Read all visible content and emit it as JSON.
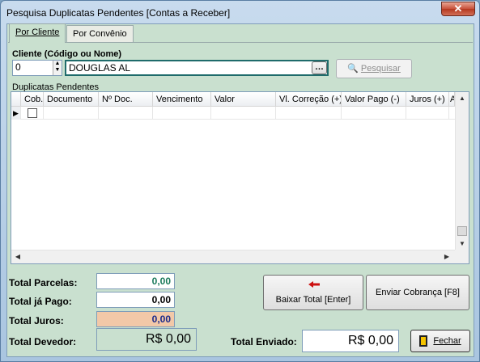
{
  "window": {
    "title": "Pesquisa Duplicatas Pendentes [Contas a Receber]",
    "close_glyph": "✕"
  },
  "tabs": [
    {
      "label": "Por Cliente",
      "active": true
    },
    {
      "label": "Por Convênio",
      "active": false
    }
  ],
  "cliente": {
    "label": "Cliente (Código ou Nome)",
    "code": "0",
    "name": "DOUGLAS AL",
    "ellipsis": "…",
    "search_button": "Pesquisar"
  },
  "grid": {
    "title": "Duplicatas Pendentes",
    "columns": [
      "Cob.",
      "Documento",
      "Nº Doc.",
      "Vencimento",
      "Valor",
      "Vl. Correção (+)",
      "Valor Pago (-)",
      "Juros (+)",
      "A"
    ],
    "row_indicator": "▶"
  },
  "totals": {
    "parcelas_label": "Total Parcelas:",
    "parcelas_value": "0,00",
    "pago_label": "Total já Pago:",
    "pago_value": "0,00",
    "juros_label": "Total Juros:",
    "juros_value": "0,00",
    "devedor_label": "Total Devedor:",
    "devedor_value": "R$ 0,00",
    "enviado_label": "Total Enviado:",
    "enviado_value": "R$ 0,00"
  },
  "buttons": {
    "baixar": "Baixar Total [Enter]",
    "enviar": "Enviar Cobrança [F8]",
    "fechar": "Fechar"
  },
  "colors": {
    "parcelas_value": "#1a7a5a",
    "juros_value": "#1a2a8a",
    "juros_bg": "#f2c8a8",
    "devedor_bg": "#c9e0cf",
    "arrow": "#cc1111"
  }
}
